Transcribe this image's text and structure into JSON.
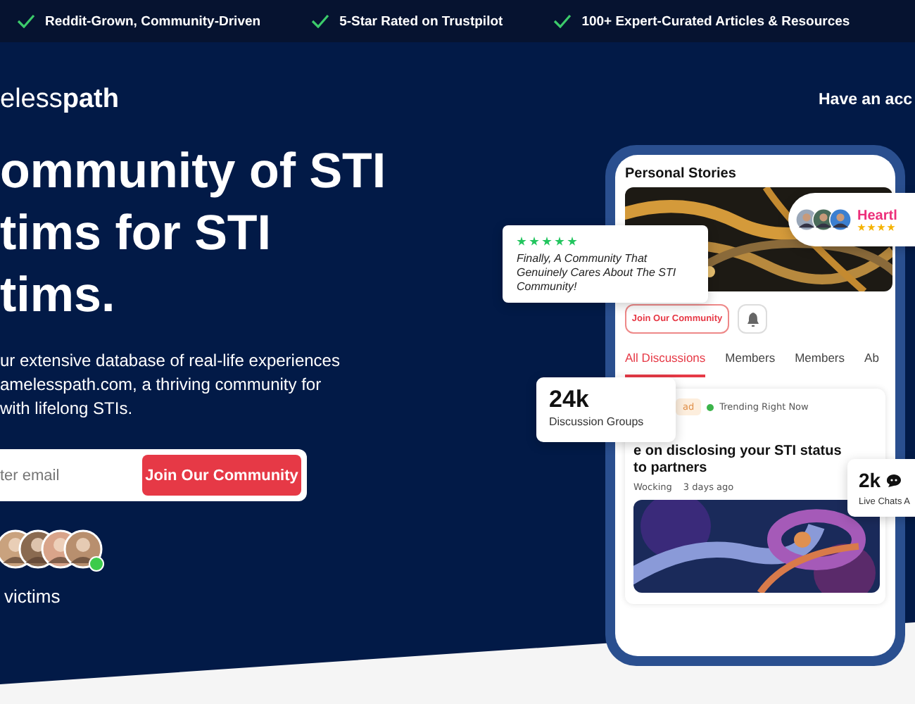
{
  "top_bar": {
    "items": [
      "Reddit-Grown, Community-Driven",
      "5-Star Rated on Trustpilot",
      "100+ Expert-Curated Articles & Resources"
    ]
  },
  "header": {
    "logo": "eless**path**",
    "account_link": "Have an acc"
  },
  "hero": {
    "headline": [
      "ommunity of STI",
      "tims for STI",
      "tims."
    ],
    "description": [
      "ur extensive database of real-life experiences",
      "amelesspath.com, a thriving community for",
      "with lifelong STIs."
    ],
    "email": {
      "placeholder": "ter email"
    },
    "join_button": "Join Our Community",
    "avatars": [
      {
        "color": "#c9a27e"
      },
      {
        "color": "#8a6a50"
      },
      {
        "color": "#d9a48a"
      },
      {
        "color": "#b88f6e"
      }
    ],
    "online": true,
    "members_label": "victims"
  },
  "phone": {
    "section_title": "Personal Stories",
    "join_button": "Join Our Community",
    "tabs": [
      {
        "label": "All Discussions",
        "selected": true
      },
      {
        "label": "Members",
        "selected": false
      },
      {
        "label": "Members",
        "selected": false
      },
      {
        "label": "Ab",
        "selected": false
      }
    ],
    "post": {
      "badge": "ad",
      "trending": "Trending Right Now",
      "title": "e on disclosing your STI status\nto partners",
      "author": "Wocking",
      "time": "3 days ago"
    }
  },
  "review_card": {
    "stars": 5,
    "quote": "Finally, A Community That Genuinely Cares About The STI Community!"
  },
  "stat_cards": [
    {
      "value": "24k",
      "label": "Discussion Groups",
      "kind": "plain"
    },
    {
      "value": "2k",
      "label": "Live Chats A",
      "kind": "chat"
    }
  ],
  "rating_pill": {
    "name": "Heartl",
    "stars": 4,
    "avatars": [
      {
        "color": "#9aa7b8"
      },
      {
        "color": "#4a6b5a"
      },
      {
        "color": "#3b7fd0"
      }
    ]
  }
}
